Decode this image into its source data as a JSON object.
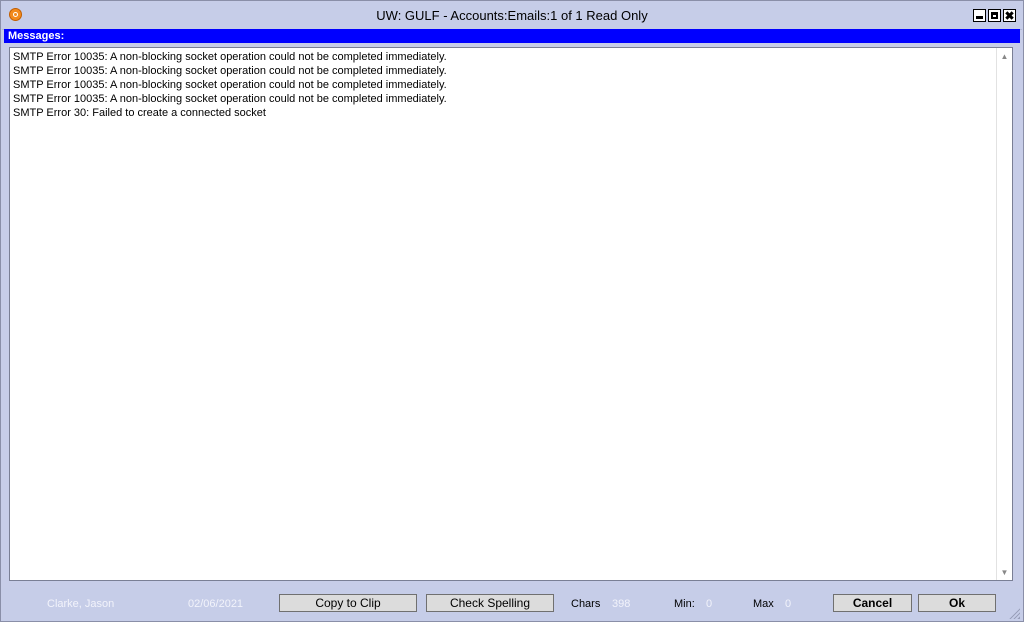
{
  "window": {
    "title": "UW: GULF - Accounts:Emails:1 of 1 Read Only",
    "icons": {
      "app": "app-logo-icon",
      "minimize": "minimize-icon",
      "maximize": "maximize-icon",
      "close": "close-icon"
    }
  },
  "section": {
    "header": "Messages:"
  },
  "messages": [
    "SMTP Error 10035: A non-blocking socket operation could not be completed immediately.",
    "SMTP Error 10035: A non-blocking socket operation could not be completed immediately.",
    "SMTP Error 10035: A non-blocking socket operation could not be completed immediately.",
    "SMTP Error 10035: A non-blocking socket operation could not be completed immediately.",
    "SMTP Error 30: Failed to create a connected socket"
  ],
  "statusbar": {
    "user": "Clarke, Jason",
    "date": "02/06/2021",
    "copy_label": "Copy to Clip",
    "spell_label": "Check Spelling",
    "chars_label": "Chars",
    "chars_value": "398",
    "min_label": "Min:",
    "min_value": "0",
    "max_label": "Max",
    "max_value": "0",
    "cancel_label": "Cancel",
    "ok_label": "Ok"
  },
  "colors": {
    "header_bg": "#0000ff",
    "window_bg": "#c6cde8"
  }
}
